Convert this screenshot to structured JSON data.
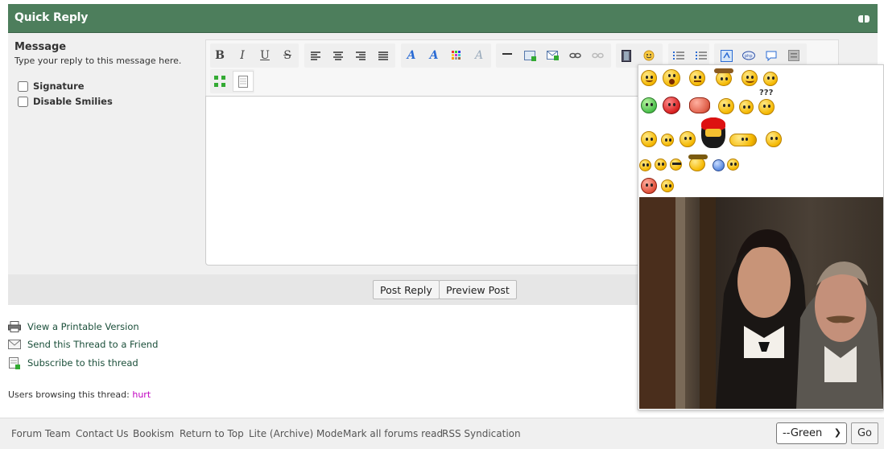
{
  "quick_reply": {
    "title": "Quick Reply"
  },
  "message": {
    "label": "Message",
    "hint": "Type your reply to this message here."
  },
  "options": {
    "signature": "Signature",
    "disable_smilies": "Disable Smilies"
  },
  "toolbar": {
    "bold": "B",
    "italic": "I",
    "underline": "U",
    "strike": "S"
  },
  "buttons": {
    "post_reply": "Post Reply",
    "preview_post": "Preview Post"
  },
  "thread_links": [
    {
      "label": "View a Printable Version",
      "icon": "printer-icon"
    },
    {
      "label": "Send this Thread to a Friend",
      "icon": "envelope-icon"
    },
    {
      "label": "Subscribe to this thread",
      "icon": "subscribe-icon"
    }
  ],
  "browsing": {
    "prefix": "Users browsing this thread:",
    "user": "hurt"
  },
  "footer": {
    "links": [
      "Forum Team",
      "Contact Us",
      "Bookism",
      "Return to Top",
      "Lite (Archive) Mode",
      "Mark all forums read",
      "RSS Syndication"
    ],
    "theme_selected": "--Green",
    "go_label": "Go"
  },
  "smiley_popup": {
    "question_text": "???"
  },
  "colors": {
    "header_green": "#4d7e5c",
    "link_green": "#1b4f3a",
    "user_magenta": "#c000c0"
  }
}
